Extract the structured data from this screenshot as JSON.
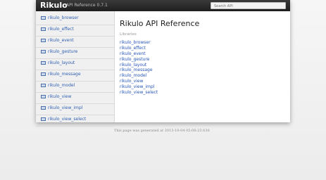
{
  "header": {
    "logo": "Rikulo",
    "title": "API Reference 0.7.1",
    "search_placeholder": "Search API"
  },
  "sidebar": {
    "items": [
      {
        "label": "rikulo_browser"
      },
      {
        "label": "rikulo_effect"
      },
      {
        "label": "rikulo_event"
      },
      {
        "label": "rikulo_gesture"
      },
      {
        "label": "rikulo_layout"
      },
      {
        "label": "rikulo_message"
      },
      {
        "label": "rikulo_model"
      },
      {
        "label": "rikulo_view"
      },
      {
        "label": "rikulo_view_impl"
      },
      {
        "label": "rikulo_view_select"
      }
    ]
  },
  "main": {
    "title": "Rikulo API Reference",
    "libraries_heading": "Libraries",
    "libraries": [
      "rikulo_browser",
      "rikulo_effect",
      "rikulo_event",
      "rikulo_gesture",
      "rikulo_layout",
      "rikulo_message",
      "rikulo_model",
      "rikulo_view",
      "rikulo_view_impl",
      "rikulo_view_select"
    ]
  },
  "footer": {
    "text": "This page was generated at 2013-10-04 05:08:23.630"
  },
  "colors": {
    "topbar": "#262626",
    "link": "#2855b8",
    "sidebar_bg": "#f0f0f0"
  }
}
